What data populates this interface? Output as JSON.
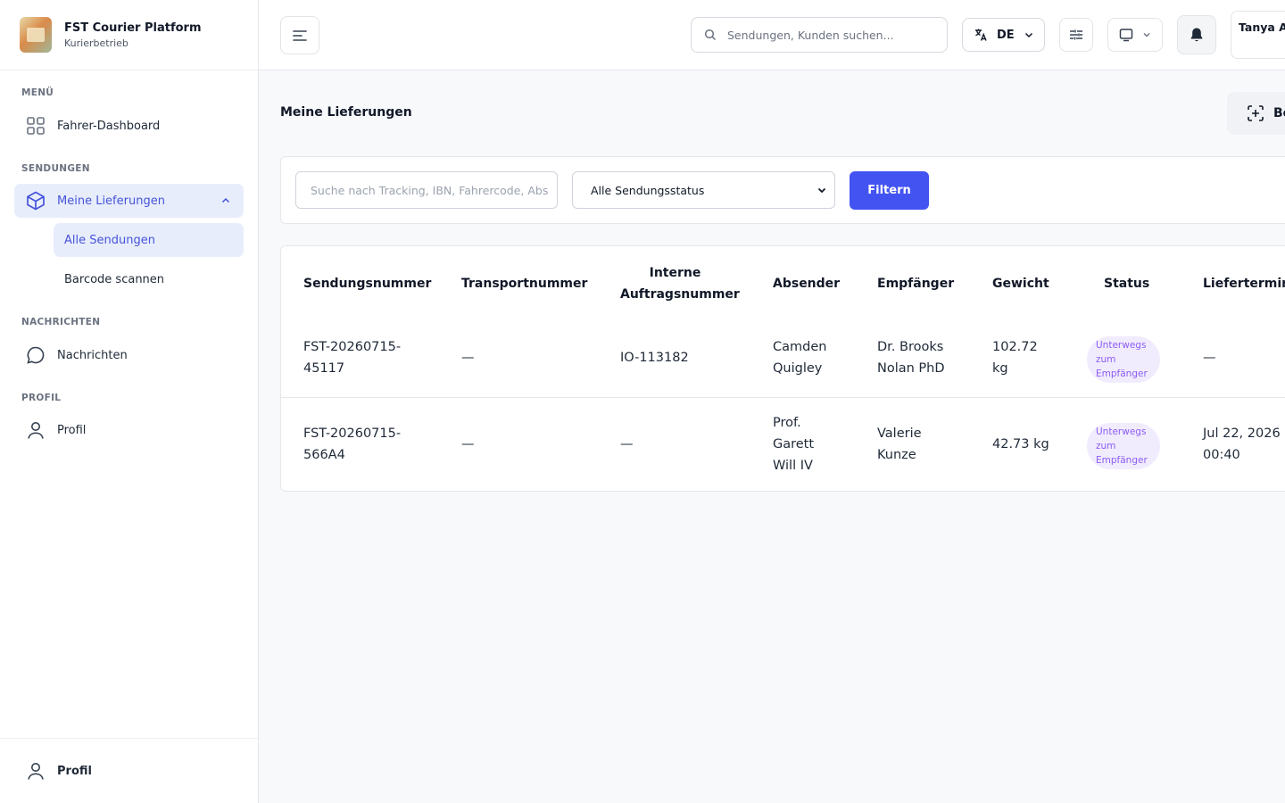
{
  "brand": {
    "title": "FST Courier Platform",
    "subtitle": "Kurierbetrieb"
  },
  "sidebar": {
    "sections": [
      {
        "label": "MENÜ"
      },
      {
        "label": "SENDUNGEN"
      },
      {
        "label": "NACHRICHTEN"
      },
      {
        "label": "PROFIL"
      }
    ],
    "items": {
      "dashboard": "Fahrer-Dashboard",
      "deliveries": "Meine Lieferungen",
      "all_shipments": "Alle Sendungen",
      "scan_barcode": "Barcode scannen",
      "messages": "Nachrichten",
      "profile": "Profil"
    },
    "footer_profile": "Profil"
  },
  "topbar": {
    "search_placeholder": "Sendungen, Kunden suchen...",
    "language": "DE",
    "user_name": "Tanya Ar"
  },
  "main": {
    "title": "Meine Lieferungen",
    "scan_button": "Bo",
    "filter": {
      "search_placeholder": "Suche nach Tracking, IBN, Fahrercode, Abs",
      "status_selected": "Alle Sendungsstatus",
      "button": "Filtern"
    },
    "table": {
      "headers": {
        "shipment": "Sendungsnummer",
        "transport": "Transportnummer",
        "internal_1": "Interne",
        "internal_2": "Auftragsnummer",
        "sender": "Absender",
        "recipient": "Empfänger",
        "weight": "Gewicht",
        "status": "Status",
        "delivery": "Liefertermin"
      },
      "rows": [
        {
          "shipment_1": "FST-20260715-",
          "shipment_2": "45117",
          "transport": "—",
          "internal": "IO-113182",
          "sender_1": "Camden",
          "sender_2": "Quigley",
          "recipient_1": "Dr. Brooks",
          "recipient_2": "Nolan PhD",
          "weight_1": "102.72",
          "weight_2": "kg",
          "status_1": "Unterwegs",
          "status_2": "zum",
          "status_3": "Empfänger",
          "delivery": "—"
        },
        {
          "shipment_1": "FST-20260715-",
          "shipment_2": "566A4",
          "transport": "—",
          "internal": "—",
          "sender_1": "Prof.",
          "sender_2": "Garett",
          "sender_3": "Will IV",
          "recipient_1": "Valerie",
          "recipient_2": "Kunze",
          "weight": "42.73 kg",
          "status_1": "Unterwegs",
          "status_2": "zum",
          "status_3": "Empfänger",
          "delivery_1": "Jul 22, 2026",
          "delivery_2": "00:40"
        }
      ]
    }
  },
  "colors": {
    "accent": "#4353f2",
    "active_bg": "#e8edfc",
    "active_text": "#4553d9",
    "badge_bg": "#f1ecfd",
    "badge_text": "#8b5cf6"
  }
}
